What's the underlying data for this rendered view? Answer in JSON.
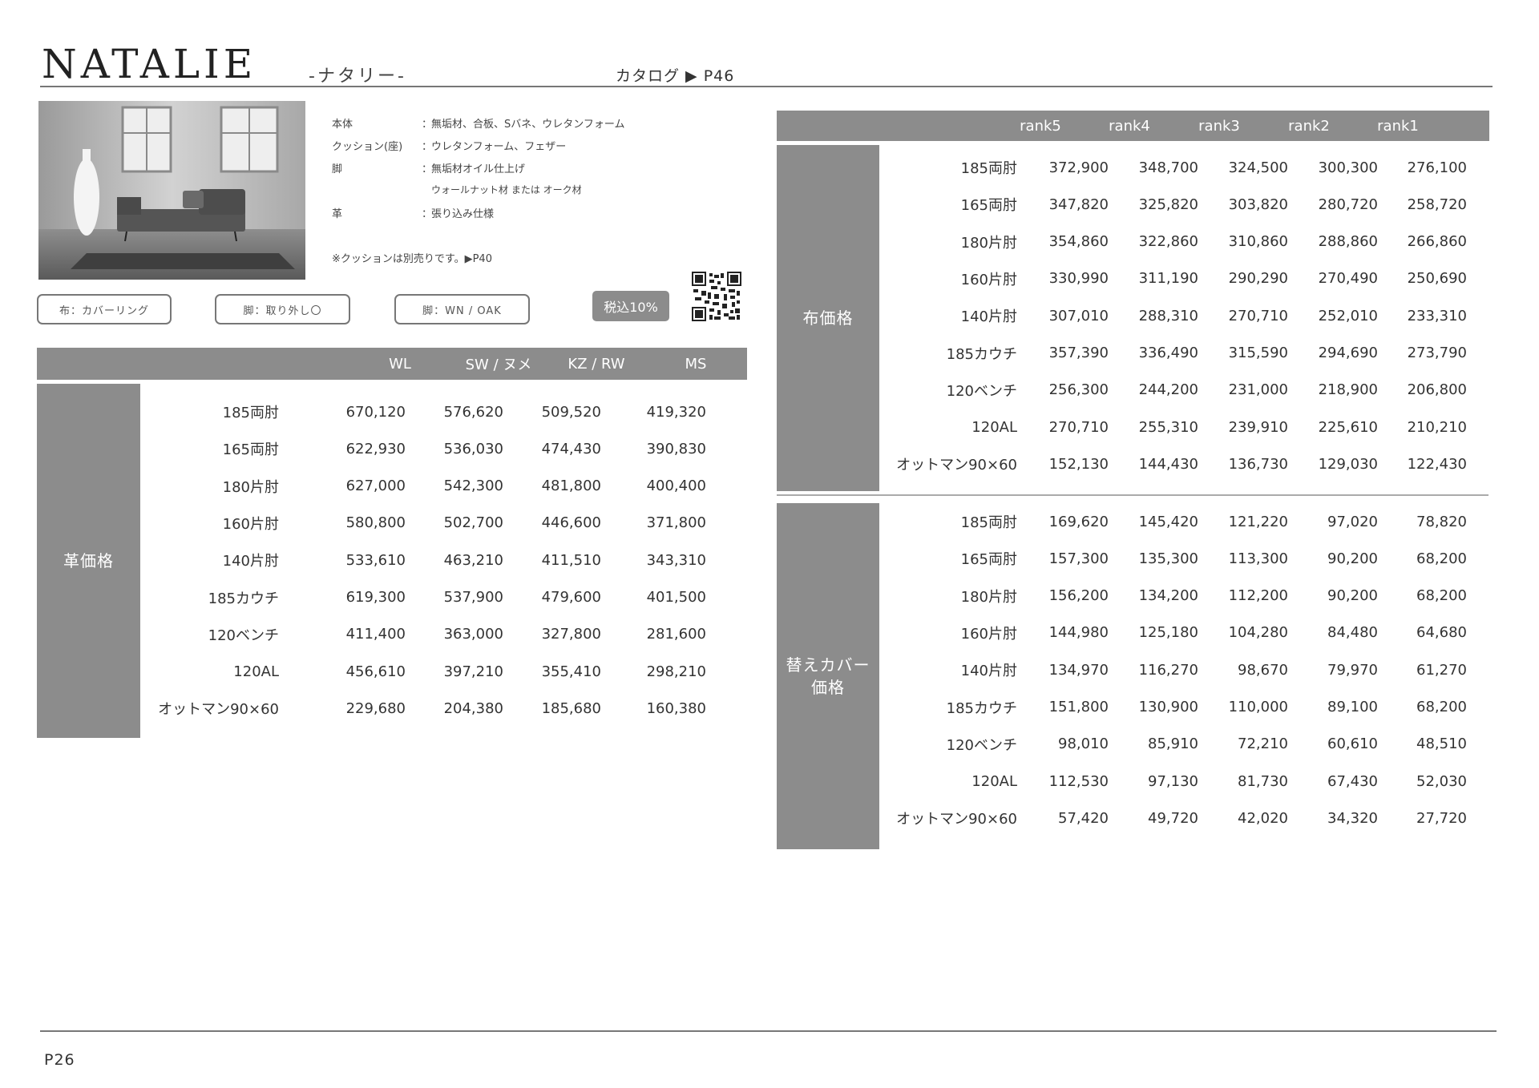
{
  "header": {
    "title": "NATALIE",
    "subtitle": "-ナタリー-",
    "catalog": "カタログ ▶ P46"
  },
  "specs": [
    {
      "label": "本体",
      "value": "無垢材、合板、Sバネ、ウレタンフォーム"
    },
    {
      "label": "クッション(座)",
      "value": "ウレタンフォーム、フェザー"
    },
    {
      "label": "脚",
      "value": "無垢材オイル仕上げ"
    },
    {
      "label": "",
      "value": "ウォールナット材 または オーク材"
    },
    {
      "label": "革",
      "value": "張り込み仕様"
    }
  ],
  "note": "※クッションは別売りです。▶P40",
  "tags": {
    "fabric": "布：カバーリング",
    "leg_removable": "脚：取り外し〇",
    "leg_type": "脚：WN / OAK",
    "tax": "税込10%"
  },
  "icons": {
    "photo": "sofa-photo",
    "qr": "qr-code-icon"
  },
  "leather_table": {
    "side_label": "革価格",
    "columns": [
      "WL",
      "SW / ヌメ",
      "KZ / RW",
      "MS"
    ],
    "rows": [
      {
        "name": "185両肘",
        "values": [
          "670,120",
          "576,620",
          "509,520",
          "419,320"
        ]
      },
      {
        "name": "165両肘",
        "values": [
          "622,930",
          "536,030",
          "474,430",
          "390,830"
        ]
      },
      {
        "name": "180片肘",
        "values": [
          "627,000",
          "542,300",
          "481,800",
          "400,400"
        ]
      },
      {
        "name": "160片肘",
        "values": [
          "580,800",
          "502,700",
          "446,600",
          "371,800"
        ]
      },
      {
        "name": "140片肘",
        "values": [
          "533,610",
          "463,210",
          "411,510",
          "343,310"
        ]
      },
      {
        "name": "185カウチ",
        "values": [
          "619,300",
          "537,900",
          "479,600",
          "401,500"
        ]
      },
      {
        "name": "120ベンチ",
        "values": [
          "411,400",
          "363,000",
          "327,800",
          "281,600"
        ]
      },
      {
        "name": "120AL",
        "values": [
          "456,610",
          "397,210",
          "355,410",
          "298,210"
        ]
      },
      {
        "name": "オットマン90×60",
        "values": [
          "229,680",
          "204,380",
          "185,680",
          "160,380"
        ]
      }
    ]
  },
  "rank_columns": [
    "rank5",
    "rank4",
    "rank3",
    "rank2",
    "rank1"
  ],
  "fabric_table": {
    "side_label": "布価格",
    "rows": [
      {
        "name": "185両肘",
        "values": [
          "372,900",
          "348,700",
          "324,500",
          "300,300",
          "276,100"
        ]
      },
      {
        "name": "165両肘",
        "values": [
          "347,820",
          "325,820",
          "303,820",
          "280,720",
          "258,720"
        ]
      },
      {
        "name": "180片肘",
        "values": [
          "354,860",
          "322,860",
          "310,860",
          "288,860",
          "266,860"
        ]
      },
      {
        "name": "160片肘",
        "values": [
          "330,990",
          "311,190",
          "290,290",
          "270,490",
          "250,690"
        ]
      },
      {
        "name": "140片肘",
        "values": [
          "307,010",
          "288,310",
          "270,710",
          "252,010",
          "233,310"
        ]
      },
      {
        "name": "185カウチ",
        "values": [
          "357,390",
          "336,490",
          "315,590",
          "294,690",
          "273,790"
        ]
      },
      {
        "name": "120ベンチ",
        "values": [
          "256,300",
          "244,200",
          "231,000",
          "218,900",
          "206,800"
        ]
      },
      {
        "name": "120AL",
        "values": [
          "270,710",
          "255,310",
          "239,910",
          "225,610",
          "210,210"
        ]
      },
      {
        "name": "オットマン90×60",
        "values": [
          "152,130",
          "144,430",
          "136,730",
          "129,030",
          "122,430"
        ]
      }
    ]
  },
  "cover_table": {
    "side_label_1": "替えカバー",
    "side_label_2": "価格",
    "rows": [
      {
        "name": "185両肘",
        "values": [
          "169,620",
          "145,420",
          "121,220",
          "97,020",
          "78,820"
        ]
      },
      {
        "name": "165両肘",
        "values": [
          "157,300",
          "135,300",
          "113,300",
          "90,200",
          "68,200"
        ]
      },
      {
        "name": "180片肘",
        "values": [
          "156,200",
          "134,200",
          "112,200",
          "90,200",
          "68,200"
        ]
      },
      {
        "name": "160片肘",
        "values": [
          "144,980",
          "125,180",
          "104,280",
          "84,480",
          "64,680"
        ]
      },
      {
        "name": "140片肘",
        "values": [
          "134,970",
          "116,270",
          "98,670",
          "79,970",
          "61,270"
        ]
      },
      {
        "name": "185カウチ",
        "values": [
          "151,800",
          "130,900",
          "110,000",
          "89,100",
          "68,200"
        ]
      },
      {
        "name": "120ベンチ",
        "values": [
          "98,010",
          "85,910",
          "72,210",
          "60,610",
          "48,510"
        ]
      },
      {
        "name": "120AL",
        "values": [
          "112,530",
          "97,130",
          "81,730",
          "67,430",
          "52,030"
        ]
      },
      {
        "name": "オットマン90×60",
        "values": [
          "57,420",
          "49,720",
          "42,020",
          "34,320",
          "27,720"
        ]
      }
    ]
  },
  "footer": {
    "page": "P26"
  }
}
